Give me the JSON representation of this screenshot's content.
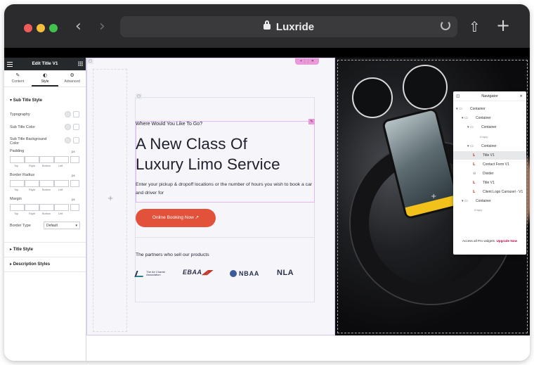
{
  "browser": {
    "url": "Luxride",
    "back_glyph": "‹",
    "forward_glyph": "›",
    "share_glyph": "⇧",
    "new_tab_glyph": "+"
  },
  "panel": {
    "title": "Edit Title V1",
    "tabs": [
      {
        "label": "Content",
        "icon": "✎"
      },
      {
        "label": "Style",
        "icon": "◐"
      },
      {
        "label": "Advanced",
        "icon": "⚙"
      }
    ],
    "section": "Sub Title Style",
    "rows": {
      "typography": "Typography",
      "sub_title_color": "Sub Title Color",
      "sub_title_bg_color": "Sub Title Background Color",
      "padding": "Padding",
      "border_radius": "Border Radius",
      "margin": "Margin",
      "border_type": "Border Type"
    },
    "unit": "px",
    "dim_labels": [
      "Top",
      "Right",
      "Bottom",
      "Left"
    ],
    "border_type_value": "Default",
    "collapsed_sections": [
      "Title Style",
      "Description Styles"
    ]
  },
  "page": {
    "eyebrow": "Where Would You Like To Go?",
    "heading_line1": "A New Class Of",
    "heading_line2": "Luxury Limo Service",
    "description": "Enter your pickup & dropoff locations or the number of hours you wish to book a car and driver for",
    "cta_label": "Online Booking Now ↗",
    "partners_title": "The partners who sell our products",
    "partners": [
      {
        "name": "The Air Charter Association"
      },
      {
        "name": "EBAA"
      },
      {
        "name": "NBAA"
      },
      {
        "name": "NLA"
      }
    ]
  },
  "navigator": {
    "title": "Navigator",
    "items": [
      {
        "label": "Container",
        "depth": 0,
        "kind": "container"
      },
      {
        "label": "Container",
        "depth": 1,
        "kind": "container"
      },
      {
        "label": "Container",
        "depth": 2,
        "kind": "container"
      },
      {
        "label": "Empty",
        "depth": 3,
        "kind": "empty"
      },
      {
        "label": "Container",
        "depth": 2,
        "kind": "container"
      },
      {
        "label": "Title V1",
        "depth": 3,
        "kind": "widget",
        "selected": true
      },
      {
        "label": "Contact Form V1",
        "depth": 3,
        "kind": "widget"
      },
      {
        "label": "Divider",
        "depth": 3,
        "kind": "divider"
      },
      {
        "label": "Title V1",
        "depth": 3,
        "kind": "widget"
      },
      {
        "label": "Client Logo Carousel - V1",
        "depth": 3,
        "kind": "widget"
      },
      {
        "label": "Container",
        "depth": 1,
        "kind": "container"
      },
      {
        "label": "Empty",
        "depth": 2,
        "kind": "empty"
      }
    ],
    "footer_text": "Access all Pro widgets.",
    "footer_link": "Upgrade Now"
  },
  "colors": {
    "accent_cta": "#e2523a",
    "selection": "#e89bd8",
    "upgrade_link": "#b30f4a"
  }
}
